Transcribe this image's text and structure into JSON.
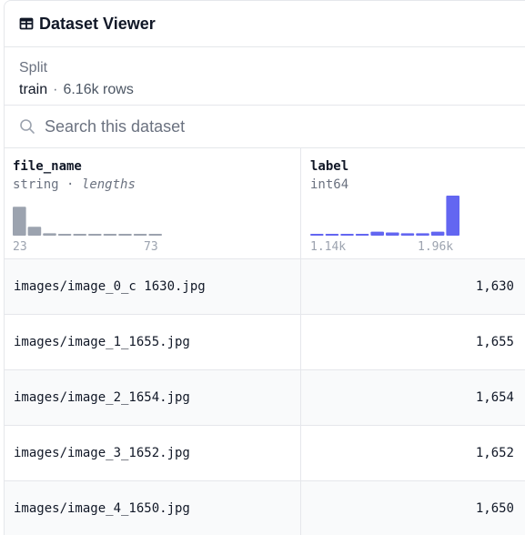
{
  "header": {
    "title": "Dataset Viewer",
    "icon": "table-icon"
  },
  "split": {
    "label": "Split",
    "name": "train",
    "separator": "·",
    "row_count": "6.16k rows"
  },
  "search": {
    "placeholder": "Search this dataset",
    "icon": "search-icon"
  },
  "columns": [
    {
      "name": "file_name",
      "type": "string",
      "type_sep": "·",
      "type_extra": "lengths",
      "axis_min": "23",
      "axis_max": "73",
      "hist_color": "#9ca3af",
      "hist_values": [
        0.72,
        0.22,
        0.06,
        0.04,
        0.04,
        0.04,
        0.04,
        0.04,
        0.04,
        0.04
      ]
    },
    {
      "name": "label",
      "type": "int64",
      "axis_min": "1.14k",
      "axis_max": "1.96k",
      "hist_color": "#6366f1",
      "hist_values": [
        0.04,
        0.04,
        0.04,
        0.04,
        0.1,
        0.08,
        0.06,
        0.06,
        0.1,
        1.0
      ]
    }
  ],
  "rows": [
    {
      "file_name": "images/image_0_c 1630.jpg",
      "label": "1,630"
    },
    {
      "file_name": "images/image_1_1655.jpg",
      "label": "1,655"
    },
    {
      "file_name": "images/image_2_1654.jpg",
      "label": "1,654"
    },
    {
      "file_name": "images/image_3_1652.jpg",
      "label": "1,652"
    },
    {
      "file_name": "images/image_4_1650.jpg",
      "label": "1,650"
    }
  ]
}
